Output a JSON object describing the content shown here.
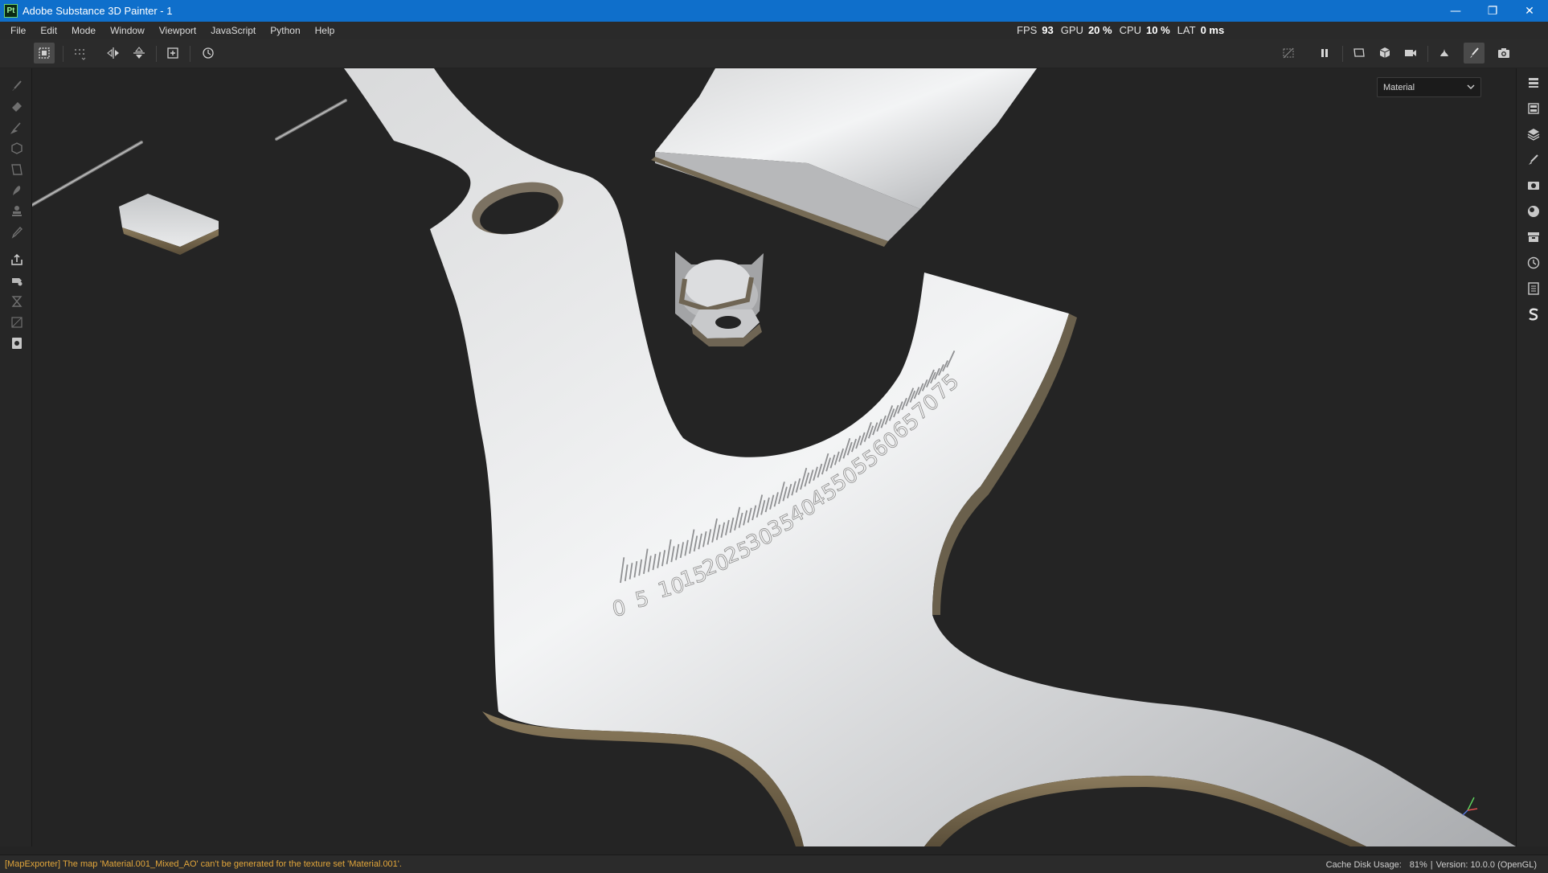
{
  "window": {
    "app_icon_text": "Pt",
    "title": "Adobe Substance 3D Painter - 1",
    "minimize_glyph": "—",
    "restore_glyph": "❐",
    "close_glyph": "✕"
  },
  "menu": {
    "items": [
      "File",
      "Edit",
      "Mode",
      "Window",
      "Viewport",
      "JavaScript",
      "Python",
      "Help"
    ]
  },
  "perf": {
    "fps_label": "FPS",
    "fps_value": "93",
    "gpu_label": "GPU",
    "gpu_value": "20 %",
    "cpu_label": "CPU",
    "cpu_value": "10 %",
    "lat_label": "LAT",
    "lat_value": "0 ms"
  },
  "toolbar": {
    "left_icons": [
      "selection-mode-icon",
      "grid-dots-icon",
      "symmetry-x-icon",
      "symmetry-y-icon",
      "add-frame-icon",
      "reset-history-icon"
    ],
    "right_icons": [
      "hide-overlay-icon",
      "pause-icon",
      "camera-frame-icon",
      "cube-view-icon",
      "video-camera-icon",
      "bake-icon",
      "paint-brush-icon",
      "screenshot-camera-icon"
    ]
  },
  "left_tools": [
    "paint-icon",
    "eraser-icon",
    "projection-icon",
    "geometry-fill-icon",
    "polygon-fill-icon",
    "smudge-icon",
    "clone-icon",
    "color-picker-icon",
    "export-icon",
    "bake-mesh-icon",
    "hourglass-icon",
    "uv-icon",
    "render-icon"
  ],
  "right_panels": [
    "texture-set-list-icon",
    "texture-set-settings-icon",
    "layers-icon",
    "properties-icon",
    "display-settings-icon",
    "shader-settings-icon",
    "assets-icon",
    "history-icon",
    "log-icon",
    "substance-icon"
  ],
  "viewport": {
    "mode_value": "Material",
    "ruler_labels": [
      "0",
      "5",
      "10",
      "15",
      "20",
      "25",
      "30",
      "35",
      "40",
      "45",
      "50",
      "55",
      "60",
      "65",
      "70",
      "75"
    ]
  },
  "status": {
    "message": "[MapExporter] The map 'Material.001_Mixed_AO' can't be generated for the texture set 'Material.001'.",
    "cache_label": "Cache Disk Usage:",
    "cache_value": "81%",
    "divider": "|",
    "version": "Version: 10.0.0 (OpenGL)"
  },
  "colors": {
    "titlebar": "#0f6fcb",
    "status_warning": "#e2a63b",
    "viewport_bg": "#242424"
  }
}
